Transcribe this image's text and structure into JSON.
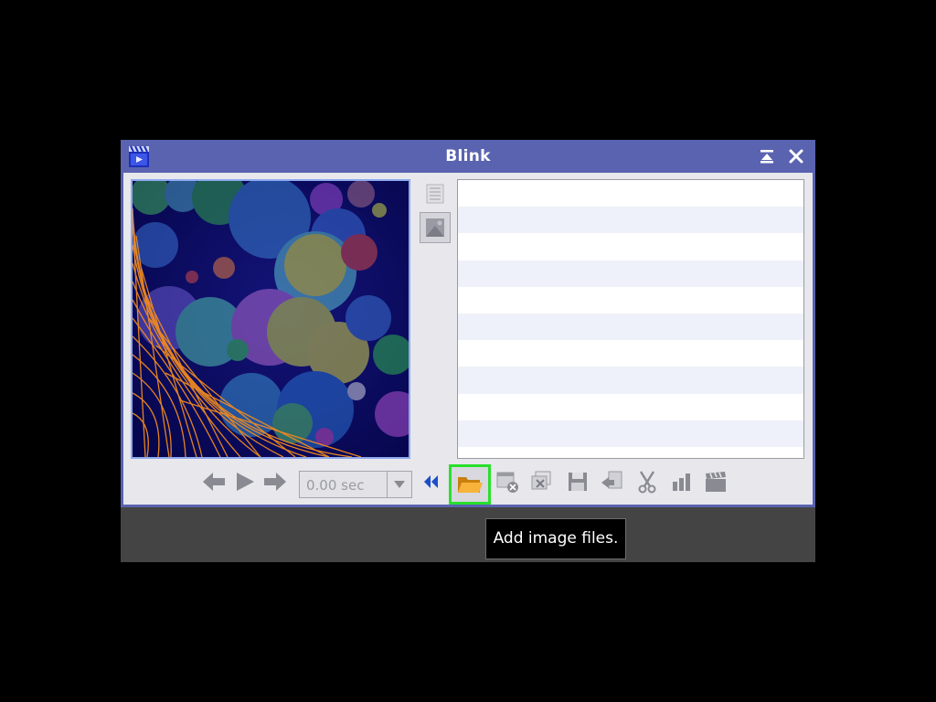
{
  "window": {
    "title": "Blink",
    "title_bar_color": "#5a63b0"
  },
  "titlebar_buttons": [
    {
      "name": "shade",
      "icon": "shade-up-icon"
    },
    {
      "name": "close",
      "icon": "close-icon"
    }
  ],
  "preview": {
    "description_icon": "preview-image"
  },
  "side_buttons": [
    {
      "icon": "list-view-icon",
      "state": "disabled"
    },
    {
      "icon": "image-view-icon",
      "state": "active"
    }
  ],
  "file_list": {
    "rows": [
      "",
      "",
      "",
      "",
      "",
      "",
      "",
      "",
      "",
      ""
    ]
  },
  "controls": {
    "delay": {
      "value": "0.00 sec"
    },
    "buttons": [
      {
        "name": "previous",
        "icon": "arrow-left-icon"
      },
      {
        "name": "play",
        "icon": "play-icon"
      },
      {
        "name": "next",
        "icon": "arrow-right-icon"
      },
      {
        "name": "collapse",
        "icon": "double-chevron-left-icon"
      },
      {
        "name": "add-image-files",
        "icon": "folder-open-icon"
      },
      {
        "name": "close-selected",
        "icon": "close-image-icon"
      },
      {
        "name": "close-all",
        "icon": "close-all-icon"
      },
      {
        "name": "save",
        "icon": "save-icon"
      },
      {
        "name": "move",
        "icon": "move-icon"
      },
      {
        "name": "crop",
        "icon": "scissors-icon"
      },
      {
        "name": "statistics",
        "icon": "bar-chart-icon"
      },
      {
        "name": "create-movie",
        "icon": "clapperboard-icon"
      }
    ]
  },
  "tooltip": {
    "text": "Add image files."
  },
  "colors": {
    "highlight": "#29e02b",
    "accent_blue": "#1d4ec9",
    "folder": "#f0a020"
  }
}
